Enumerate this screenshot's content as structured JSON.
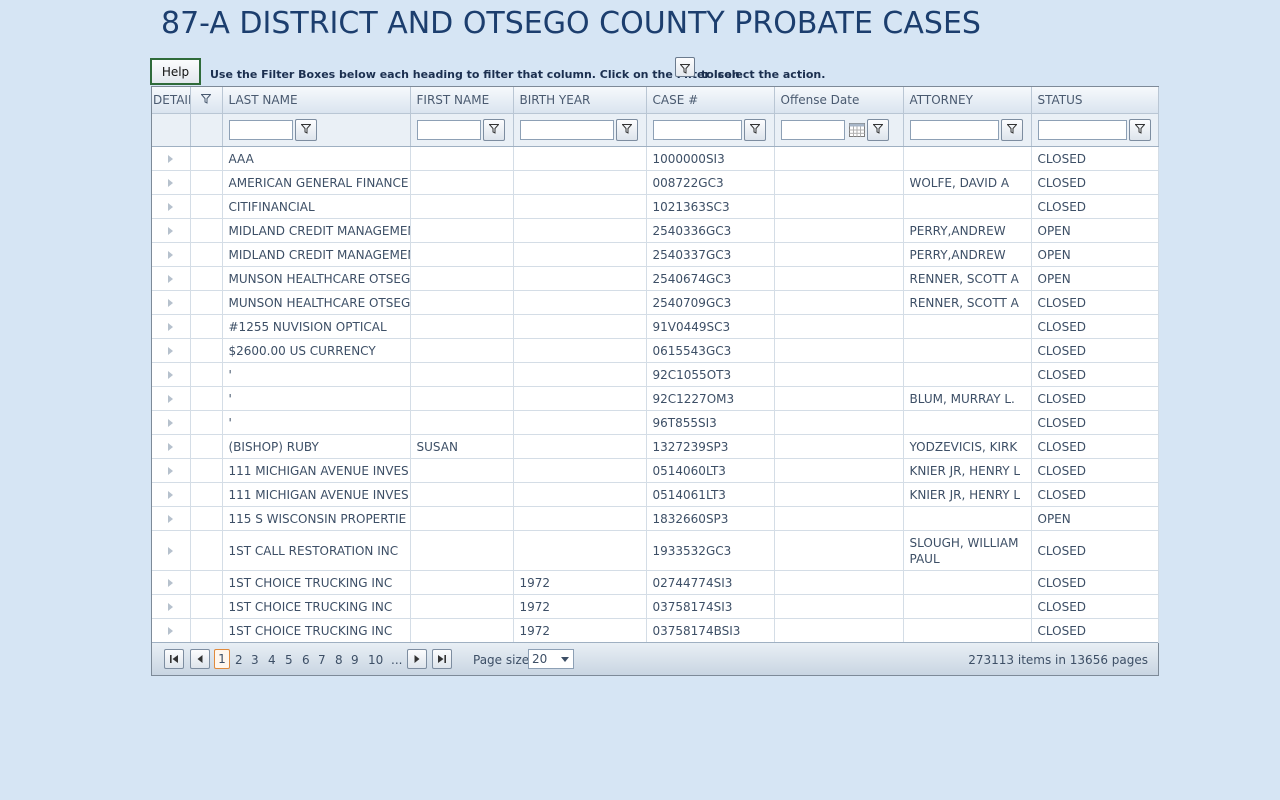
{
  "page_title": "87-A DISTRICT AND OTSEGO COUNTY PROBATE CASES",
  "help_label": "Help",
  "instructions": {
    "part1": "Use the Filter Boxes below each heading to filter that column.  Click on the Filter Icon",
    "part2": "to select the action."
  },
  "columns": [
    "DETAIL",
    "",
    "LAST NAME",
    "FIRST NAME",
    "BIRTH YEAR",
    "CASE #",
    "Offense Date",
    "ATTORNEY",
    "STATUS"
  ],
  "rows": [
    {
      "last": "AAA",
      "first": "",
      "birth": "",
      "case": "1000000SI3",
      "offense": "",
      "attorney": "",
      "status": "CLOSED"
    },
    {
      "last": "AMERICAN GENERAL FINANCE",
      "first": "",
      "birth": "",
      "case": "008722GC3",
      "offense": "",
      "attorney": "WOLFE, DAVID A",
      "status": "CLOSED"
    },
    {
      "last": "CITIFINANCIAL",
      "first": "",
      "birth": "",
      "case": "1021363SC3",
      "offense": "",
      "attorney": "",
      "status": "CLOSED"
    },
    {
      "last": "MIDLAND CREDIT MANAGEMEN",
      "first": "",
      "birth": "",
      "case": "2540336GC3",
      "offense": "",
      "attorney": "PERRY,ANDREW",
      "status": "OPEN"
    },
    {
      "last": "MIDLAND CREDIT MANAGEMEN",
      "first": "",
      "birth": "",
      "case": "2540337GC3",
      "offense": "",
      "attorney": "PERRY,ANDREW",
      "status": "OPEN"
    },
    {
      "last": "MUNSON HEALTHCARE OTSEGO",
      "first": "",
      "birth": "",
      "case": "2540674GC3",
      "offense": "",
      "attorney": "RENNER, SCOTT A",
      "status": "OPEN"
    },
    {
      "last": "MUNSON HEALTHCARE OTSEGO",
      "first": "",
      "birth": "",
      "case": "2540709GC3",
      "offense": "",
      "attorney": "RENNER, SCOTT A",
      "status": "CLOSED"
    },
    {
      "last": "#1255 NUVISION OPTICAL",
      "first": "",
      "birth": "",
      "case": "91V0449SC3",
      "offense": "",
      "attorney": "",
      "status": "CLOSED"
    },
    {
      "last": "$2600.00 US CURRENCY",
      "first": "",
      "birth": "",
      "case": "0615543GC3",
      "offense": "",
      "attorney": "",
      "status": "CLOSED"
    },
    {
      "last": "'",
      "first": "",
      "birth": "",
      "case": "92C1055OT3",
      "offense": "",
      "attorney": "",
      "status": "CLOSED"
    },
    {
      "last": "'",
      "first": "",
      "birth": "",
      "case": "92C1227OM3",
      "offense": "",
      "attorney": "BLUM, MURRAY L.",
      "status": "CLOSED"
    },
    {
      "last": "'",
      "first": "",
      "birth": "",
      "case": "96T855SI3",
      "offense": "",
      "attorney": "",
      "status": "CLOSED"
    },
    {
      "last": "(BISHOP) RUBY",
      "first": "SUSAN",
      "birth": "",
      "case": "1327239SP3",
      "offense": "",
      "attorney": "YODZEVICIS, KIRK",
      "status": "CLOSED"
    },
    {
      "last": "111 MICHIGAN AVENUE INVES",
      "first": "",
      "birth": "",
      "case": "0514060LT3",
      "offense": "",
      "attorney": "KNIER JR, HENRY L",
      "status": "CLOSED"
    },
    {
      "last": "111 MICHIGAN AVENUE INVES",
      "first": "",
      "birth": "",
      "case": "0514061LT3",
      "offense": "",
      "attorney": "KNIER JR, HENRY L",
      "status": "CLOSED"
    },
    {
      "last": "115 S WISCONSIN PROPERTIE",
      "first": "",
      "birth": "",
      "case": "1832660SP3",
      "offense": "",
      "attorney": "",
      "status": "OPEN"
    },
    {
      "last": "1ST CALL RESTORATION INC",
      "first": "",
      "birth": "",
      "case": "1933532GC3",
      "offense": "",
      "attorney": "SLOUGH, WILLIAM PAUL",
      "status": "CLOSED",
      "tall": true
    },
    {
      "last": "1ST CHOICE TRUCKING INC",
      "first": "",
      "birth": "1972",
      "case": "02744774SI3",
      "offense": "",
      "attorney": "",
      "status": "CLOSED"
    },
    {
      "last": "1ST CHOICE TRUCKING INC",
      "first": "",
      "birth": "1972",
      "case": "03758174SI3",
      "offense": "",
      "attorney": "",
      "status": "CLOSED"
    },
    {
      "last": "1ST CHOICE TRUCKING INC",
      "first": "",
      "birth": "1972",
      "case": "03758174BSI3",
      "offense": "",
      "attorney": "",
      "status": "CLOSED"
    }
  ],
  "pager": {
    "pages": [
      "1",
      "2",
      "3",
      "4",
      "5",
      "6",
      "7",
      "8",
      "9",
      "10",
      "..."
    ],
    "current": "1",
    "page_size_label": "Page size:",
    "page_size": "20",
    "info": "273113 items in 13656 pages"
  },
  "icons": {
    "filter": "filter-icon",
    "calendar": "calendar-icon",
    "expand": "expand-arrow-icon",
    "first": "first-page-icon",
    "prev": "prev-page-icon",
    "next": "next-page-icon",
    "last": "last-page-icon"
  },
  "colors": {
    "background": "#d6e5f4",
    "title": "#1c3e6e",
    "current_page_border": "#e08a3c"
  }
}
